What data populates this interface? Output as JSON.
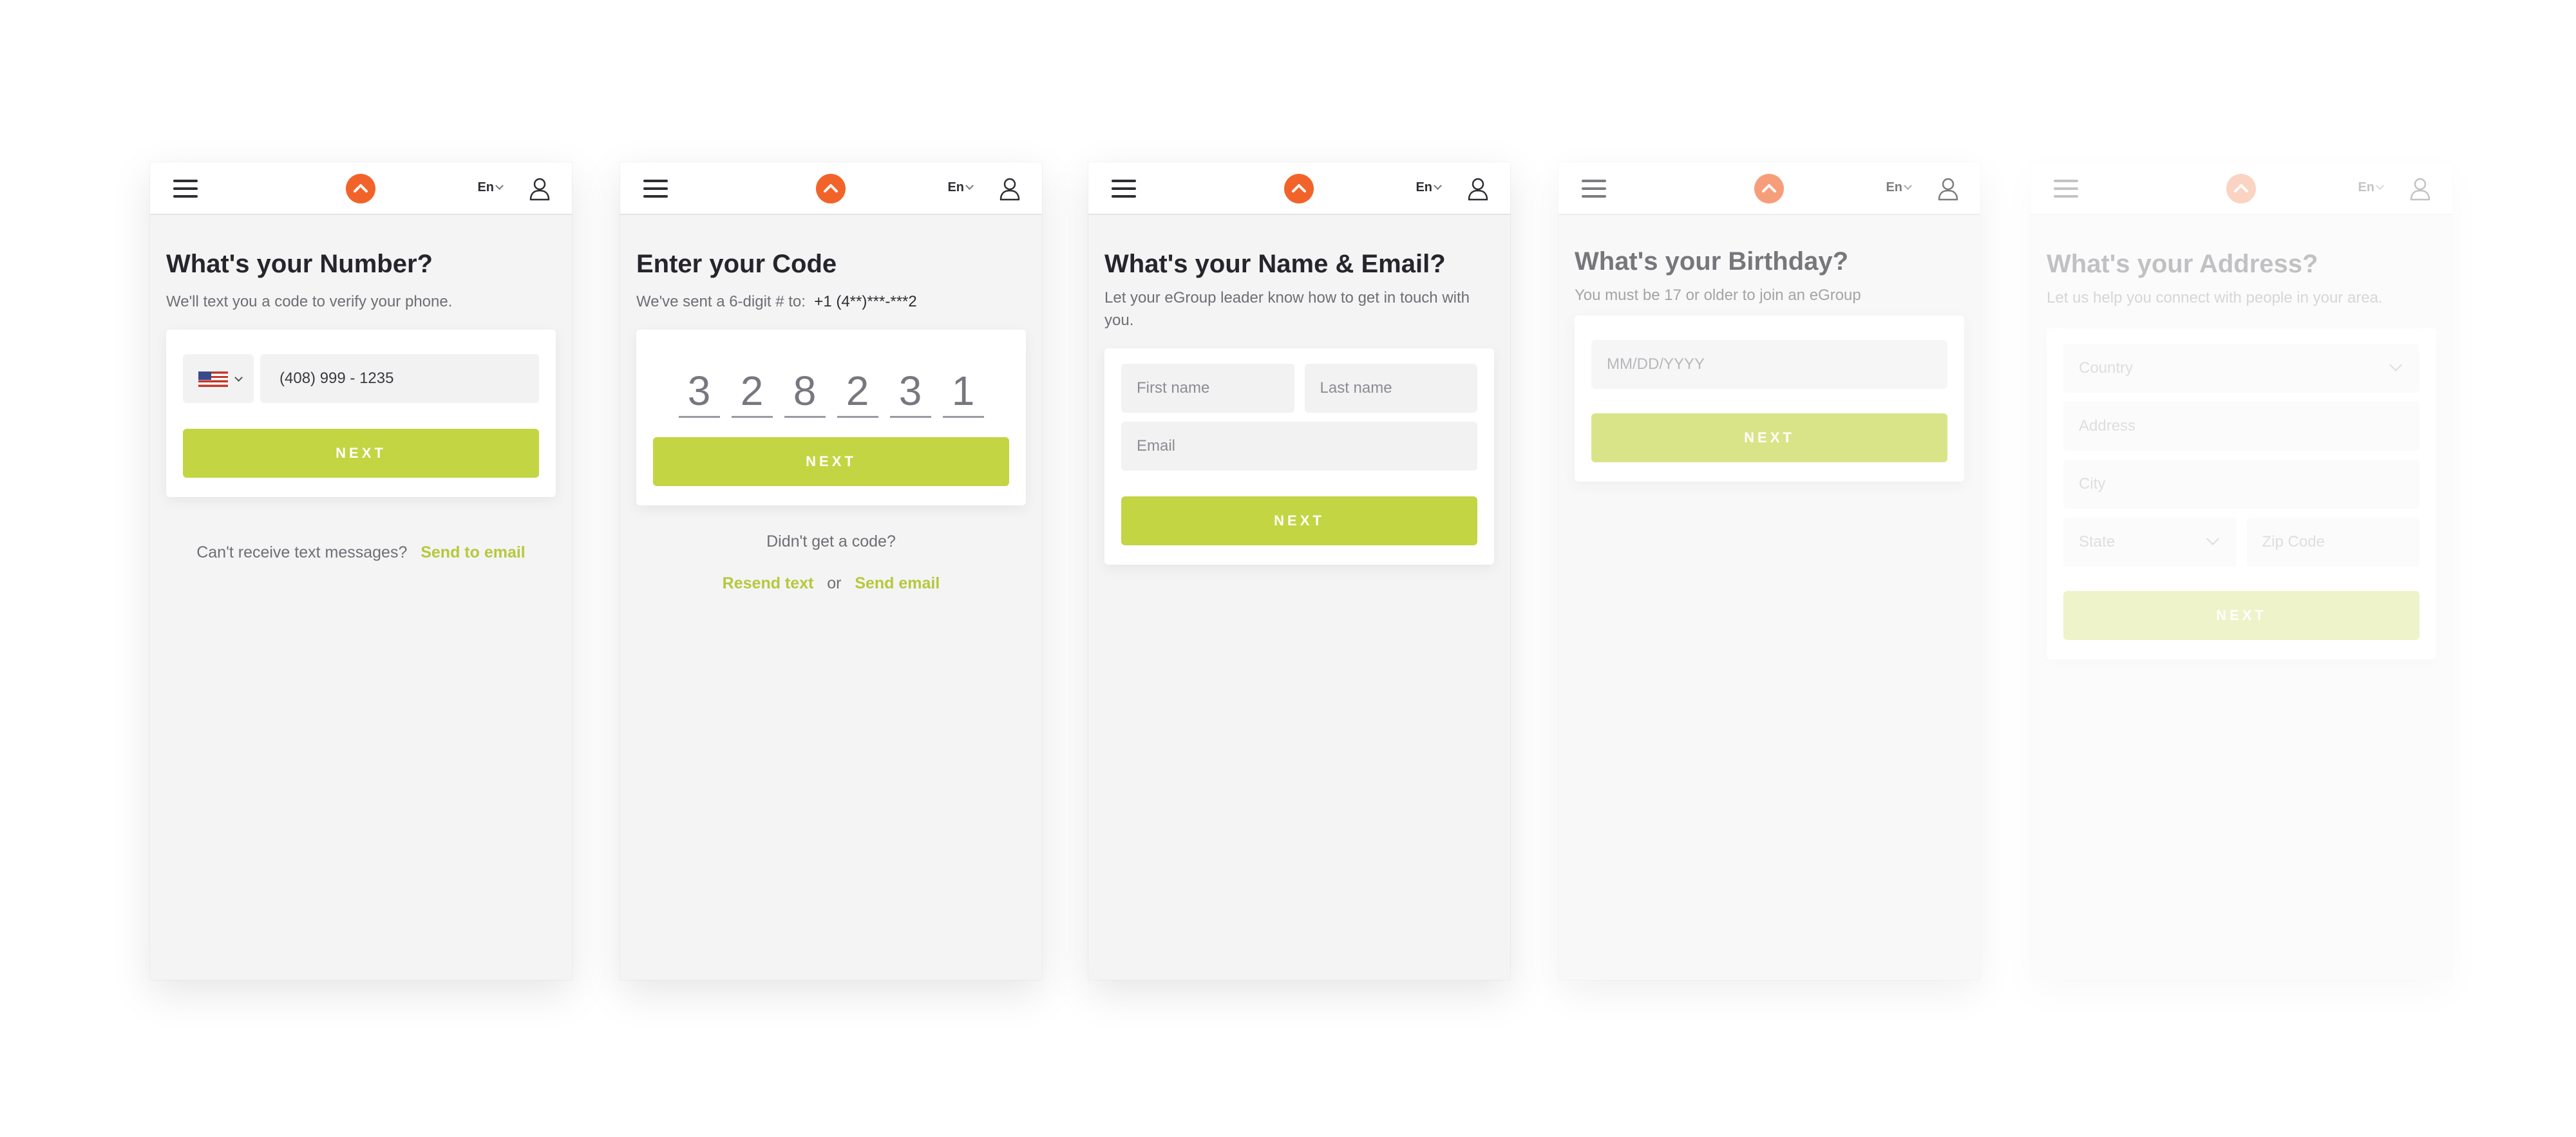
{
  "header": {
    "lang": "En"
  },
  "screens": [
    {
      "title": "What's your Number?",
      "subtitle": "We'll text you a code to verify your phone.",
      "phone_value": "(408) 999 - 1235",
      "next": "NEXT",
      "foot_text": "Can't receive text messages?",
      "foot_link": "Send to email"
    },
    {
      "title": "Enter your Code",
      "subtitle": "We've sent a 6-digit # to:",
      "subtitle_number": "+1 (4**)***-***2",
      "digits": [
        "3",
        "2",
        "8",
        "2",
        "3",
        "1"
      ],
      "next": "NEXT",
      "foot_text": "Didn't get a code?",
      "resend": "Resend text",
      "or": "or",
      "send_email": "Send email"
    },
    {
      "title": "What's your Name & Email?",
      "subtitle": "Let your eGroup leader know how to get in touch with you.",
      "first_name": "First name",
      "last_name": "Last name",
      "email": "Email",
      "next": "NEXT"
    },
    {
      "title": "What's your Birthday?",
      "subtitle": "You must be 17 or older to join an eGroup",
      "birthday": "MM/DD/YYYY",
      "next": "NEXT"
    },
    {
      "title": "What's your Address?",
      "subtitle": "Let us help you connect with people in your area.",
      "country": "Country",
      "address": "Address",
      "city": "City",
      "state": "State",
      "zip": "Zip Code",
      "next": "NEXT"
    }
  ],
  "colors": {
    "accent": "#c3d542",
    "brand": "#f2632a",
    "background": "#f4f4f5"
  },
  "icons": [
    "hamburger-icon",
    "logo-icon",
    "chevron-down-icon",
    "user-icon",
    "us-flag-icon"
  ]
}
